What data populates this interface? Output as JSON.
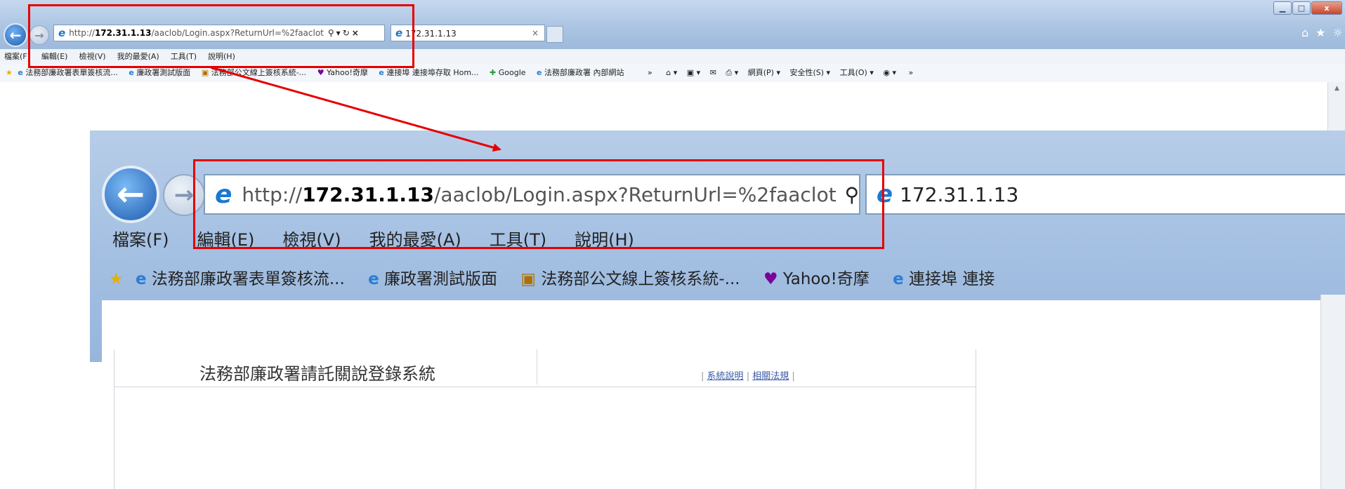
{
  "browser_small": {
    "url_prefix": "http://",
    "url_host": "172.31.1.13",
    "url_rest": "/aaclob/Login.aspx?ReturnUrl=%2faaclot",
    "tab_title": "172.31.1.13",
    "tab_close": "×",
    "search_glyph": "⚲",
    "refresh_glyph": "↻",
    "stop_glyph": "×",
    "dropdown_glyph": "▾",
    "home_glyph": "⌂",
    "fav_glyph": "★",
    "gear_glyph": "☼"
  },
  "window_controls": {
    "minimize": "▁",
    "maximize": "□",
    "close": "x"
  },
  "menu": [
    "檔案(F)",
    "編輯(E)",
    "檢視(V)",
    "我的最愛(A)",
    "工具(T)",
    "說明(H)"
  ],
  "favorites_small": [
    "法務部廉政署表單簽核流...",
    "廉政署測試版面",
    "法務部公文線上簽核系統-...",
    "Yahoo!奇摩",
    "連接埠 連接埠存取 Hom...",
    "Google",
    "法務部廉政署 內部網站"
  ],
  "command_bar": {
    "chevron": "»",
    "page": "網頁(P)",
    "safety": "安全性(S)",
    "tools": "工具(O)",
    "chevron2": "»"
  },
  "browser_big": {
    "url_prefix": "http://",
    "url_host": "172.31.1.13",
    "url_rest": "/aaclob/Login.aspx?ReturnUrl=%2faaclot",
    "tab_title": "172.31.1.13"
  },
  "favorites_big": [
    "法務部廉政署表單簽核流...",
    "廉政署測試版面",
    "法務部公文線上簽核系統-...",
    "Yahoo!奇摩",
    "連接埠 連接"
  ],
  "site": {
    "title": "法務部廉政署請託關說登錄系統",
    "link_system": "系統說明",
    "link_laws": "相關法規",
    "sep": "|"
  },
  "colors": {
    "highlight": "#e60000",
    "chrome": "#a9c3e2"
  }
}
